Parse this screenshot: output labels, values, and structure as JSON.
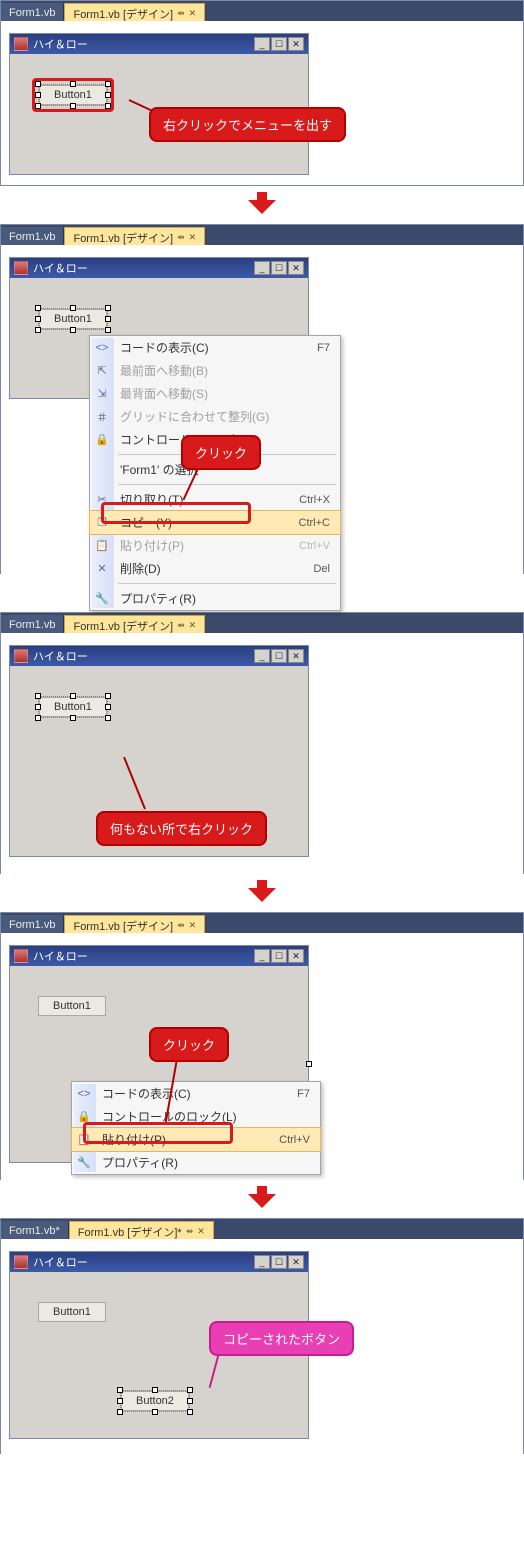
{
  "tabs": {
    "inactive": "Form1.vb",
    "active": "Form1.vb [デザイン]",
    "inactive_mod": "Form1.vb*",
    "active_mod": "Form1.vb [デザイン]*"
  },
  "form": {
    "title": "ハイ＆ロー"
  },
  "buttons": {
    "b1": "Button1",
    "b2": "Button2"
  },
  "callouts": {
    "s1": "右クリックでメニューを出す",
    "s2": "クリック",
    "s3": "何もない所で右クリック",
    "s4": "クリック",
    "s5": "コピーされたボタン"
  },
  "menu1": {
    "items": [
      {
        "icon": "<>",
        "label": "コードの表示(C)",
        "shortcut": "F7"
      },
      {
        "icon": "⇱",
        "label": "最前面へ移動(B)",
        "disabled": true
      },
      {
        "icon": "⇲",
        "label": "最背面へ移動(S)",
        "disabled": true
      },
      {
        "icon": "＃",
        "label": "グリッドに合わせて整列(G)",
        "disabled": true
      },
      {
        "icon": "🔒",
        "label": "コントロールのロック(L)"
      },
      {
        "sep": true
      },
      {
        "icon": "",
        "label": "'Form1' の選択"
      },
      {
        "sep": true
      },
      {
        "icon": "✂",
        "label": "切り取り(T)",
        "shortcut": "Ctrl+X"
      },
      {
        "icon": "❐",
        "label": "コピー(Y)",
        "shortcut": "Ctrl+C",
        "hover": true
      },
      {
        "icon": "📋",
        "label": "貼り付け(P)",
        "shortcut": "Ctrl+V",
        "disabled": true
      },
      {
        "icon": "✕",
        "label": "削除(D)",
        "shortcut": "Del"
      },
      {
        "sep": true
      },
      {
        "icon": "🔧",
        "label": "プロパティ(R)"
      }
    ]
  },
  "menu2": {
    "items": [
      {
        "icon": "<>",
        "label": "コードの表示(C)",
        "shortcut": "F7"
      },
      {
        "icon": "🔒",
        "label": "コントロールのロック(L)"
      },
      {
        "icon": "📋",
        "label": "貼り付け(P)",
        "shortcut": "Ctrl+V",
        "hover": true
      },
      {
        "icon": "🔧",
        "label": "プロパティ(R)"
      }
    ]
  }
}
